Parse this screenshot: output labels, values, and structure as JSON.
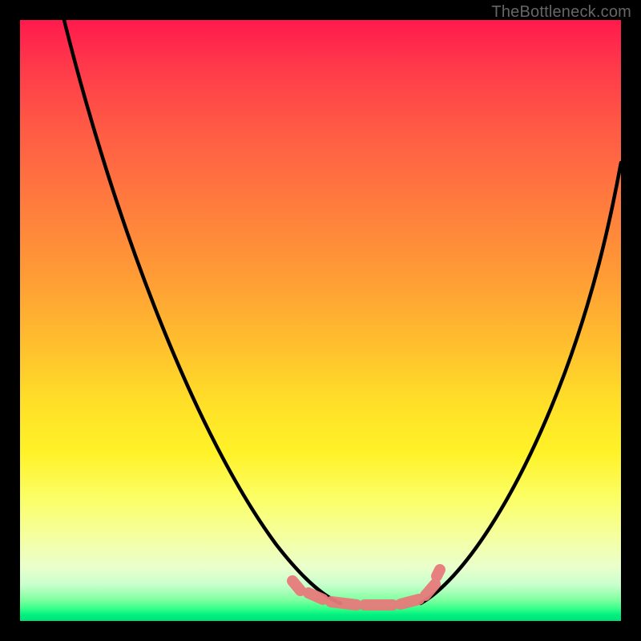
{
  "attribution": "TheBottleneck.com",
  "colors": {
    "gradient_top": "#ff1a4d",
    "gradient_mid": "#ffe028",
    "gradient_bottom": "#00e078",
    "curve": "#000000",
    "optimal_marker": "#e77b7b",
    "frame": "#000000"
  },
  "chart_data": {
    "type": "line",
    "title": "",
    "xlabel": "",
    "ylabel": "",
    "xlim": [
      0,
      100
    ],
    "ylim": [
      0,
      100
    ],
    "note": "x is a normalized balance axis (0–100); y is normalized bottleneck severity (0 = none at bottom, 100 = worst at top). Values estimated from pixel positions of the plotted black curve.",
    "series": [
      {
        "name": "bottleneck_curve_left",
        "x": [
          7,
          12,
          18,
          24,
          30,
          36,
          43,
          50,
          53
        ],
        "y": [
          100,
          80,
          62,
          48,
          36,
          25,
          14,
          5,
          3
        ]
      },
      {
        "name": "bottleneck_curve_right",
        "x": [
          67,
          72,
          78,
          84,
          90,
          96,
          100
        ],
        "y": [
          3,
          8,
          18,
          32,
          48,
          65,
          76
        ]
      }
    ],
    "optimal_zone": {
      "name": "flat_optimum_marker",
      "x_range": [
        45,
        70
      ],
      "y_approx": 3,
      "color": "#e77b7b"
    },
    "background_gradient_meaning": "Color encodes same severity scale as y: red high, yellow mid, green low."
  }
}
